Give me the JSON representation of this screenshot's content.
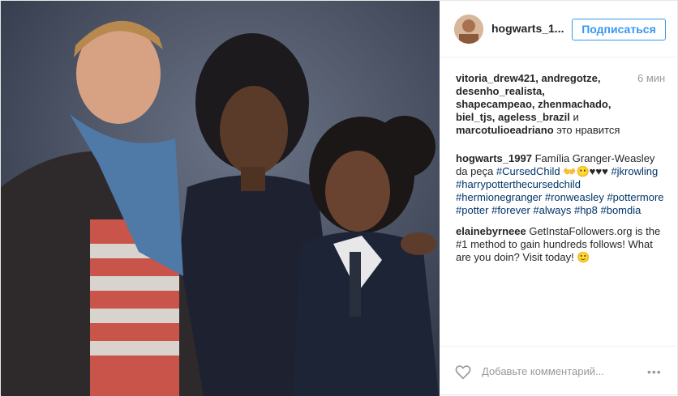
{
  "post": {
    "username": "hogwarts_1...",
    "follow_label": "Подписаться",
    "time_ago": "6 мин",
    "likes": {
      "users": "vitoria_drew421, andregotze, desenho_realista, shapecampeao, zhenmachado, biel_tjs, ageless_brazil",
      "and": "и",
      "last_user": "marcotulioeadriano",
      "suffix": "это нравится"
    },
    "caption": {
      "username": "hogwarts_1997",
      "text1": "Família Granger-Weasley da peça",
      "tag_cursed": "#CursedChild",
      "emoji": "👐😶♥♥♥",
      "hashtags": "#jkrowling #harrypotterthecursedchild #hermionegranger #ronweasley #pottermore #potter #forever #always #hp8 #bomdia"
    },
    "comment2": {
      "username": "elainebyrneee",
      "text": "GetInstaFollowers.org is the #1 method to gain hundreds follows! What are you doin? Visit today! 🙂"
    },
    "add_comment_placeholder": "Добавьте комментарий...",
    "more_label": "•••"
  },
  "icons": {
    "heart": "heart-outline-icon",
    "more": "more-dots-icon"
  },
  "colors": {
    "accent": "#3897f0",
    "hashtag": "#003569",
    "muted": "#999999",
    "photo_bg": "#3b4455"
  }
}
